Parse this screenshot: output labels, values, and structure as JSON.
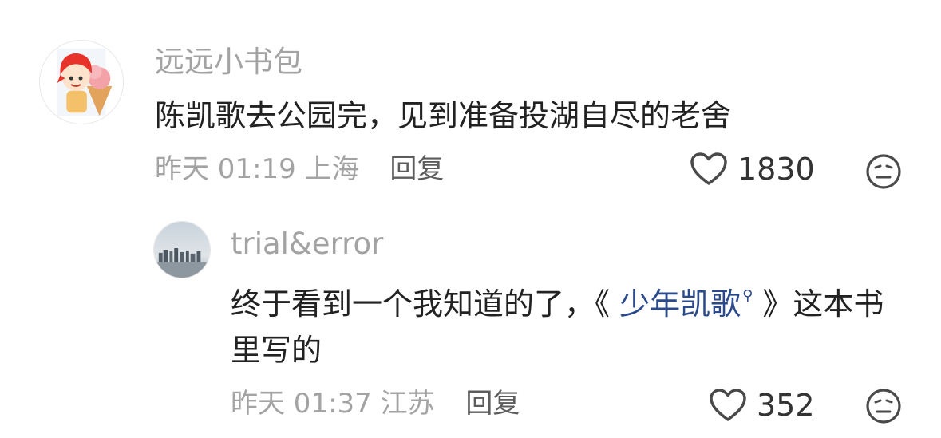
{
  "comment": {
    "username": "远远小书包",
    "text": "陈凯歌去公园完，见到准备投湖自尽的老舍",
    "time": "昨天 01:19",
    "location": "上海",
    "reply_label": "回复",
    "likes": "1830",
    "avatar_icon": "cartoon-red-hair-icecream-avatar"
  },
  "reply": {
    "username": "trial&error",
    "text_before": "终于看到一个我知道的了，《 ",
    "link_text": "少年凯歌",
    "text_after": " 》这本书里写的",
    "time": "昨天 01:37",
    "location": "江苏",
    "reply_label": "回复",
    "likes": "352",
    "avatar_icon": "city-skyline-avatar"
  },
  "colors": {
    "muted_text": "#a3a3a3",
    "body_text": "#222222",
    "link": "#2b4a8b"
  }
}
